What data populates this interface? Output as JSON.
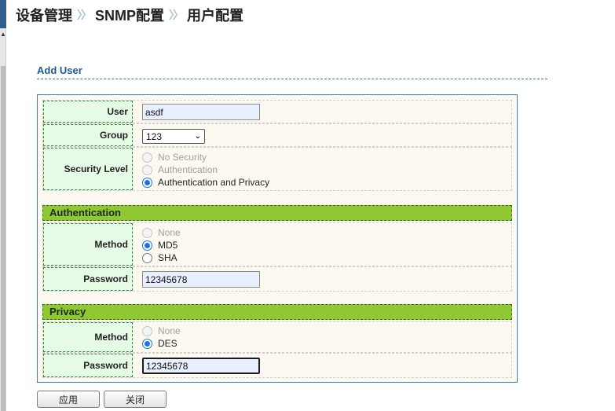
{
  "breadcrumb": {
    "items": [
      "设备管理",
      "SNMP配置",
      "用户配置"
    ],
    "separator": "〉〉"
  },
  "section_title": "Add User",
  "form": {
    "user": {
      "label": "User",
      "value": "asdf"
    },
    "group": {
      "label": "Group",
      "selected": "123"
    },
    "security_level": {
      "label": "Security Level",
      "options": [
        "No Security",
        "Authentication",
        "Authentication and Privacy"
      ],
      "selected": "Authentication and Privacy"
    },
    "authentication": {
      "header": "Authentication",
      "method": {
        "label": "Method",
        "options": [
          "None",
          "MD5",
          "SHA"
        ],
        "selected": "MD5"
      },
      "password": {
        "label": "Password",
        "value": "12345678"
      }
    },
    "privacy": {
      "header": "Privacy",
      "method": {
        "label": "Method",
        "options": [
          "None",
          "DES"
        ],
        "selected": "DES"
      },
      "password": {
        "label": "Password",
        "value": "12345678"
      }
    }
  },
  "buttons": {
    "apply": "应用",
    "close": "关闭"
  },
  "colors": {
    "label_bg": "#e6fbe5",
    "group_header_bg": "#8fc832",
    "accent": "#1f5a93",
    "radio_checked": "#1a73e8"
  }
}
